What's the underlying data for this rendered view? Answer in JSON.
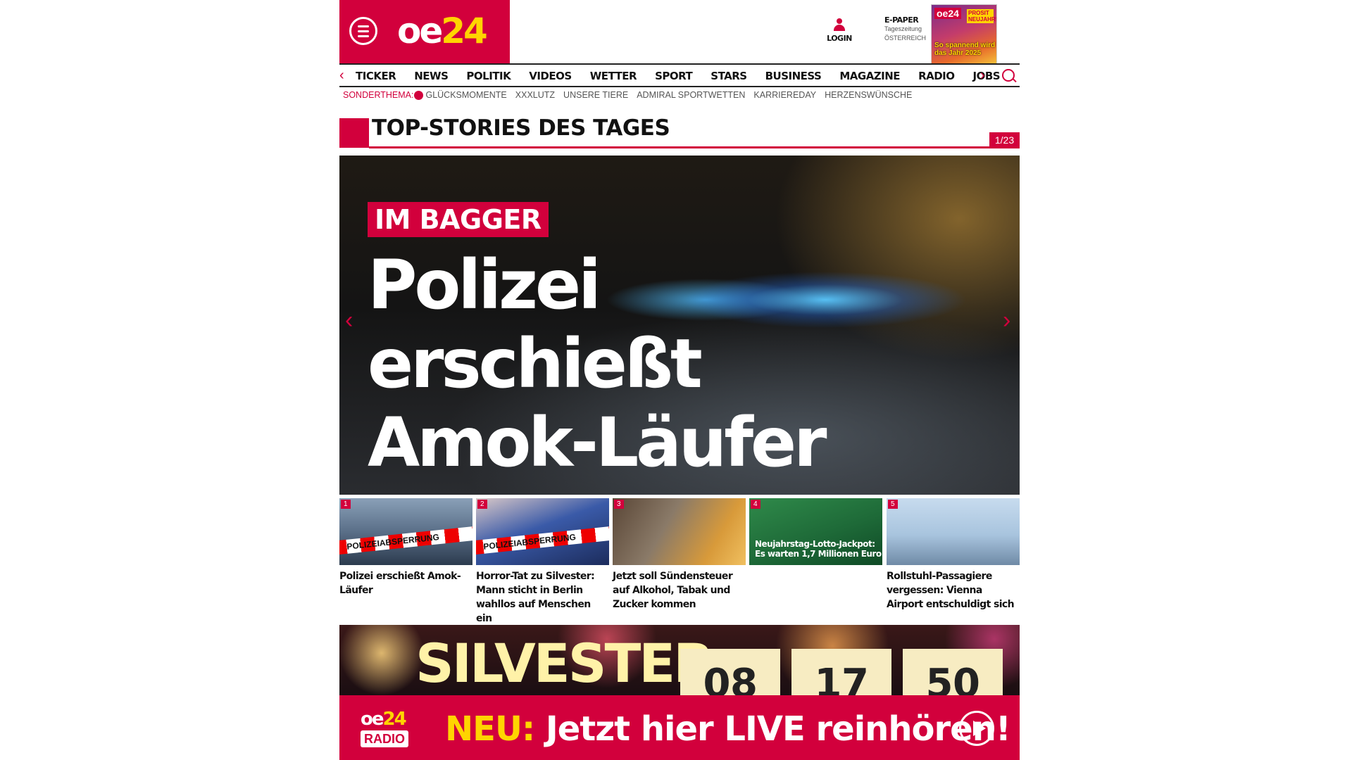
{
  "header": {
    "logo": {
      "part1": "oe",
      "part2": "24"
    },
    "login_label": "LOGIN",
    "epaper": {
      "title": "E-PAPER",
      "line1": "Tageszeitung",
      "line2": "ÖSTERREICH"
    },
    "cover": {
      "brand": "oe24",
      "badge": "PROSIT NEUJAHR!",
      "headline": "So spannend wird das Jahr 2025"
    }
  },
  "nav": {
    "items": [
      "TICKER",
      "NEWS",
      "POLITIK",
      "VIDEOS",
      "WETTER",
      "SPORT",
      "STARS",
      "BUSINESS",
      "MAGAZINE",
      "RADIO",
      "JOBS"
    ]
  },
  "topics": {
    "label": "SONDERTHEMA:",
    "items": [
      "GLÜCKSMOMENTE",
      "XXXLUTZ",
      "UNSERE TIERE",
      "ADMIRAL SPORTWETTEN",
      "KARRIEREDAY",
      "HERZENSWÜNSCHE"
    ]
  },
  "section": {
    "title": "TOP-STORIES DES TAGES",
    "counter": "1/23"
  },
  "hero": {
    "kicker": "IM BAGGER",
    "headline_lines": [
      "Polizei",
      "erschießt",
      "Amok-Läufer"
    ]
  },
  "thumbs": [
    {
      "num": "1",
      "caption": "Polizei erschießt Amok-Läufer",
      "tape": "POLIZEIABSPERRUNG"
    },
    {
      "num": "2",
      "caption": "Horror-Tat zu Silvester: Mann sticht in Berlin wahllos auf Menschen ein",
      "tape": "POLIZEIABSPERRUNG"
    },
    {
      "num": "3",
      "caption": "Jetzt soll Sündensteuer auf Alkohol, Tabak und Zucker kommen"
    },
    {
      "num": "4",
      "caption": "",
      "overlay": "Neujahrstag-Lotto-Jackpot: Es warten 1,7 Millionen Euro"
    },
    {
      "num": "5",
      "caption": "Rollstuhl-Passagiere vergessen: Vienna Airport entschuldigt sich"
    }
  ],
  "silvester": {
    "word": "SILVESTER",
    "countdown": [
      "08",
      "17",
      "50"
    ]
  },
  "radio": {
    "brand_part1": "oe",
    "brand_part2": "24",
    "tag": "RADIO",
    "neu": "NEU:",
    "message": "Jetzt hier LIVE reinhören!"
  },
  "colors": {
    "brand_red": "#d2003c",
    "brand_yellow": "#ffd400"
  }
}
